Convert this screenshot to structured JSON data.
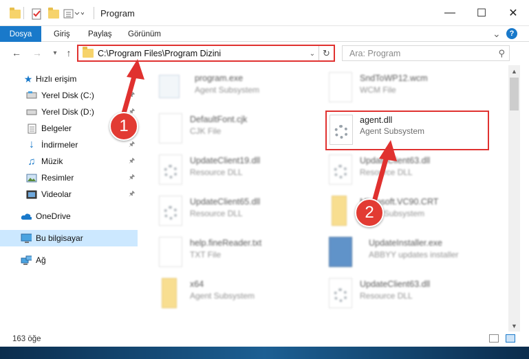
{
  "window": {
    "title": "Program",
    "minimize": "—",
    "maximize": "☐",
    "close": "✕"
  },
  "ribbon": {
    "file_tab": "Dosya",
    "tabs": [
      "Giriş",
      "Paylaş",
      "Görünüm"
    ],
    "collapse": "⌄",
    "help": "?"
  },
  "address": {
    "path": "C:\\Program Files\\Program Dizini",
    "search_placeholder": "Ara: Program"
  },
  "sidebar": {
    "items": [
      {
        "label": "Hızlı erişim",
        "icon": "star-icon",
        "pinned": false
      },
      {
        "label": "Yerel Disk (C:)",
        "icon": "drive-icon",
        "pinned": true
      },
      {
        "label": "Yerel Disk (D:)",
        "icon": "drive-icon",
        "pinned": true
      },
      {
        "label": "Belgeler",
        "icon": "documents-icon",
        "pinned": true
      },
      {
        "label": "İndirmeler",
        "icon": "download-icon",
        "pinned": true
      },
      {
        "label": "Müzik",
        "icon": "music-icon",
        "pinned": true
      },
      {
        "label": "Resimler",
        "icon": "pictures-icon",
        "pinned": true
      },
      {
        "label": "Videolar",
        "icon": "videos-icon",
        "pinned": true
      },
      {
        "label": "OneDrive",
        "icon": "cloud-icon",
        "pinned": false
      },
      {
        "label": "Bu bilgisayar",
        "icon": "computer-icon",
        "pinned": false,
        "selected": true
      },
      {
        "label": "Ağ",
        "icon": "network-icon",
        "pinned": false
      }
    ]
  },
  "files": [
    {
      "name": "program.exe",
      "type": "Agent Subsystem",
      "icon": "app-icon"
    },
    {
      "name": "SndToWP12.wcm",
      "type": "WCM File",
      "icon": "blank-file-icon"
    },
    {
      "name": "DefaultFont.cjk",
      "type": "CJK File",
      "icon": "blank-file-icon"
    },
    {
      "name": "agent.dll",
      "type": "Agent Subsystem",
      "icon": "dll-gear-icon",
      "highlighted": true
    },
    {
      "name": "UpdateClient19.dll",
      "type": "Resource DLL",
      "icon": "dll-gear-icon"
    },
    {
      "name": "UpdateClient63.dll",
      "type": "Resource DLL",
      "icon": "dll-gear-icon"
    },
    {
      "name": "UpdateClient65.dll",
      "type": "Resource DLL",
      "icon": "dll-gear-icon"
    },
    {
      "name": "Microsoft.VC90.CRT",
      "type": "Agent Subsystem",
      "icon": "folder-icon"
    },
    {
      "name": "help.fineReader.txt",
      "type": "TXT File",
      "icon": "text-file-icon"
    },
    {
      "name": "UpdateInstaller.exe",
      "type": "ABBYY updates installer",
      "icon": "installer-icon"
    },
    {
      "name": "x64",
      "type": "Agent Subsystem",
      "icon": "folder-icon"
    },
    {
      "name": "UpdateClient63.dll",
      "type": "Resource DLL",
      "icon": "dll-gear-icon"
    }
  ],
  "status": {
    "item_count": "163 öğe"
  },
  "annotations": {
    "step1": "1",
    "step2": "2",
    "color": "#e0312f"
  }
}
